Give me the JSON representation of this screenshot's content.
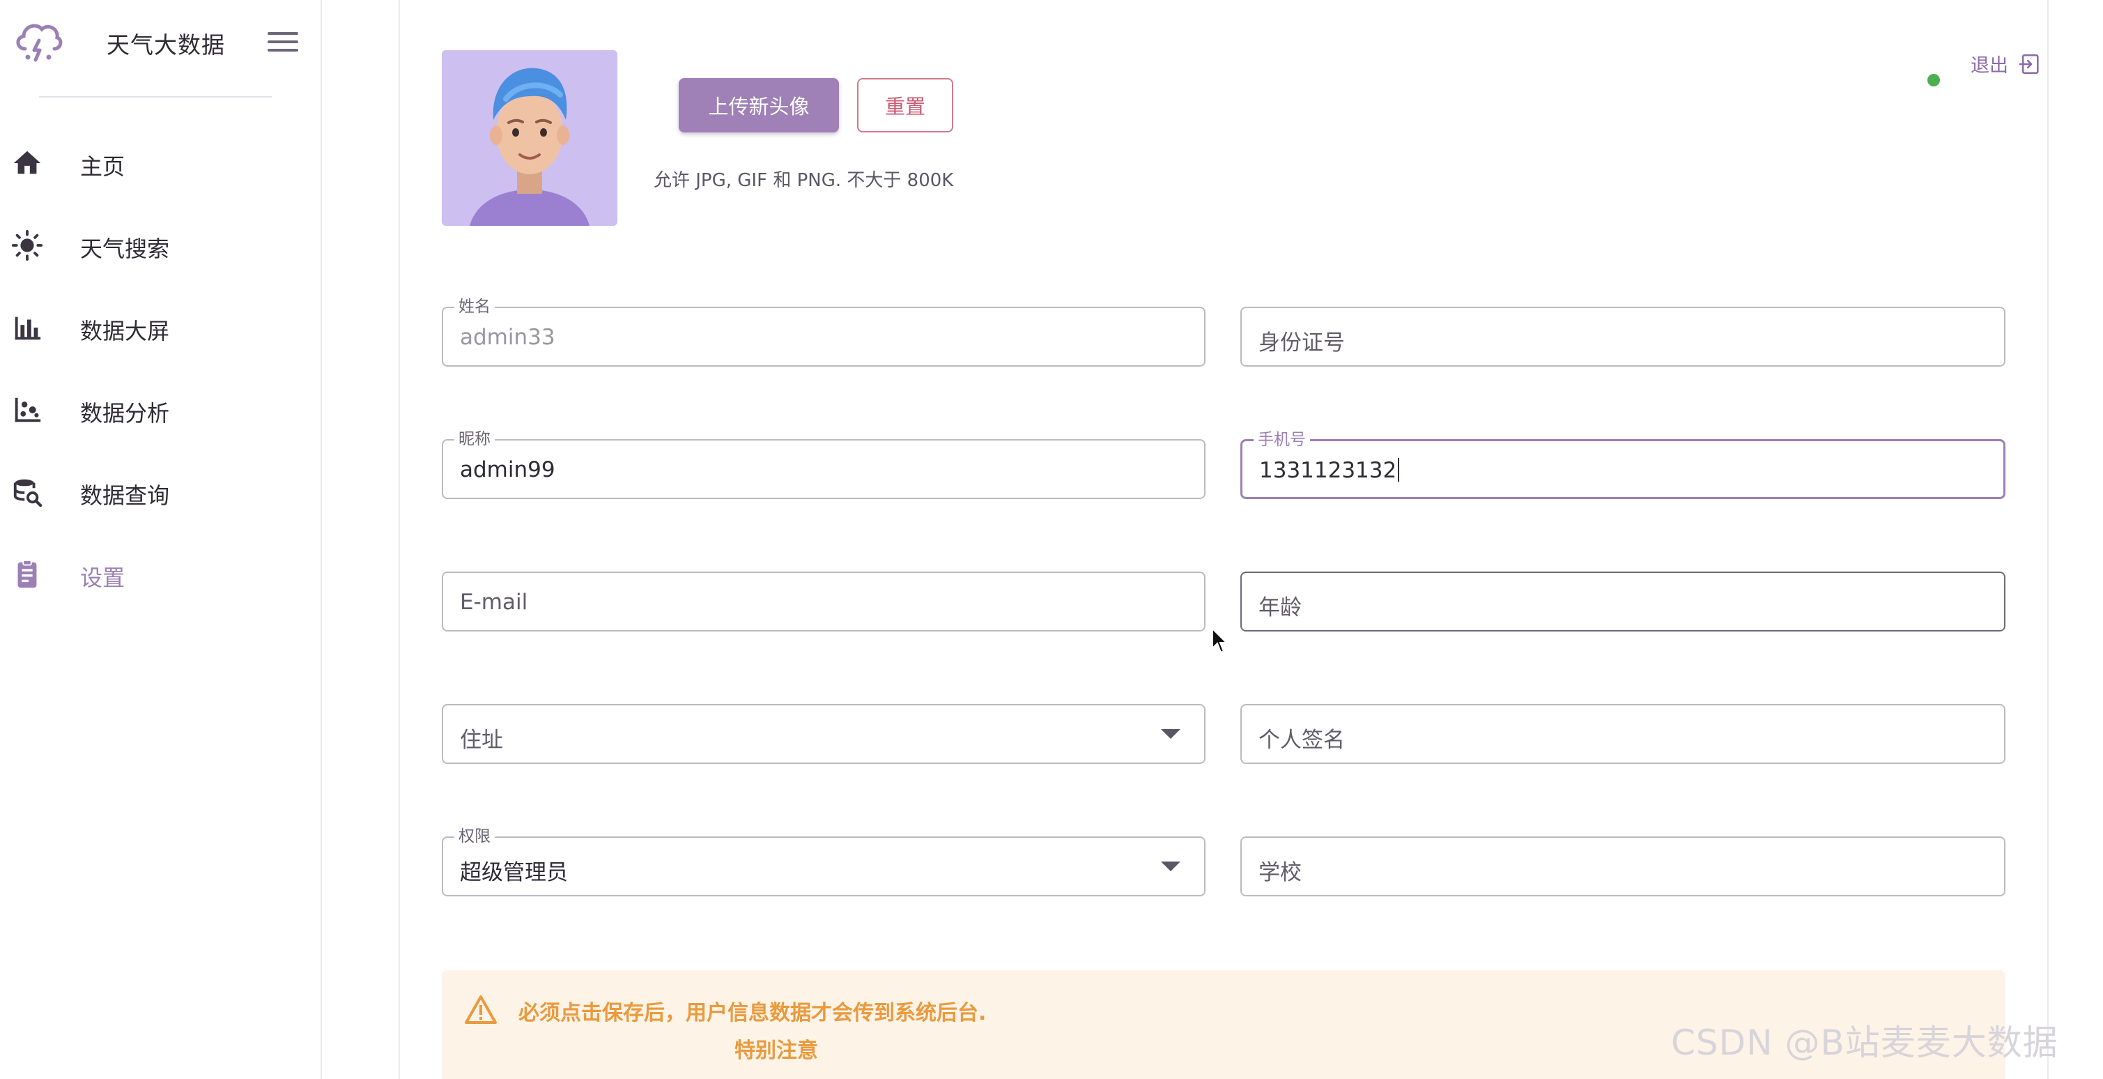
{
  "app": {
    "title": "天气大数据"
  },
  "sidebar": {
    "items": [
      {
        "label": "主页",
        "icon": "home-icon"
      },
      {
        "label": "天气搜索",
        "icon": "sun-icon"
      },
      {
        "label": "数据大屏",
        "icon": "bar-chart-icon"
      },
      {
        "label": "数据分析",
        "icon": "scatter-chart-icon"
      },
      {
        "label": "数据查询",
        "icon": "database-search-icon"
      },
      {
        "label": "设置",
        "icon": "clipboard-icon",
        "active": true
      }
    ]
  },
  "header": {
    "logout_label": "退出"
  },
  "profile": {
    "upload_label": "上传新头像",
    "reset_label": "重置",
    "hint": "允许 JPG, GIF 和 PNG. 不大于 800K"
  },
  "form": {
    "name": {
      "label": "姓名",
      "value": "admin33"
    },
    "id_number": {
      "placeholder": "身份证号"
    },
    "nickname": {
      "label": "昵称",
      "value": "admin99"
    },
    "phone": {
      "label": "手机号",
      "value": "1331123132"
    },
    "email": {
      "placeholder": "E-mail"
    },
    "age": {
      "placeholder": "年龄"
    },
    "address": {
      "placeholder": "住址"
    },
    "signature": {
      "placeholder": "个人签名"
    },
    "role": {
      "label": "权限",
      "value": "超级管理员"
    },
    "school": {
      "placeholder": "学校"
    }
  },
  "alert": {
    "message": "必须点击保存后，用户信息数据才会传到系统后台.",
    "sub": "特别注意"
  },
  "watermark": "CSDN @B站麦麦大数据",
  "colors": {
    "accent": "#9b7fb5",
    "reset": "#c85b72",
    "warning": "#e99a3d",
    "online": "#4caf50"
  }
}
